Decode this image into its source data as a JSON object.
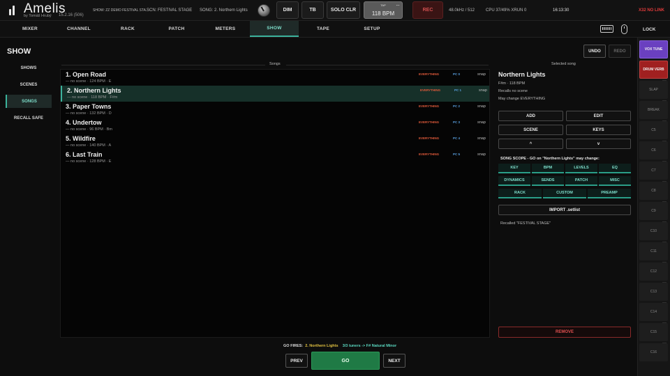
{
  "app": {
    "name": "Amelis",
    "author": "by Tomáš Hrubý",
    "version": "15.2.16 (506)"
  },
  "topbar": {
    "show": "SHOW: ZZ DEMO FESTIVAL STA...",
    "scene": "SCN: FESTIVAL STAGE",
    "song": "SONG: 2. Northern Lights",
    "dim": "DIM",
    "tb": "TB",
    "solo_clr": "SOLO CLR",
    "tap_label": "TAP",
    "tap_bpm": "118 BPM",
    "rec": "REC",
    "samplerate": "48.0kHz / 512",
    "cpu": "CPU 37/49%  XRUN 0",
    "clock": "16:13:30",
    "link_status": "X32 NO LINK"
  },
  "nav": {
    "tabs": [
      "MIXER",
      "CHANNEL",
      "RACK",
      "PATCH",
      "METERS",
      "SHOW",
      "TAPE",
      "SETUP"
    ],
    "active": "SHOW",
    "lock": "LOCK"
  },
  "page": {
    "title": "SHOW"
  },
  "sidebar": {
    "items": [
      "SHOWS",
      "SCENES",
      "SONGS",
      "RECALL SAFE"
    ],
    "active": "SONGS"
  },
  "history": {
    "undo": "UNDO",
    "redo": "REDO"
  },
  "songs": {
    "header": "Songs",
    "rows": [
      {
        "title": "1.  Open Road",
        "scene": "— no scene",
        "bpm": "124 BPM",
        "key": "E",
        "tag": "EVERYTHING",
        "pc": "PC 0",
        "snap": "snap"
      },
      {
        "title": "2.  Northern Lights",
        "scene": "— no scene",
        "bpm": "118 BPM",
        "key": "F#m",
        "tag": "EVERYTHING",
        "pc": "PC 1",
        "snap": "snap"
      },
      {
        "title": "3.  Paper Towns",
        "scene": "— no scene",
        "bpm": "132 BPM",
        "key": "D",
        "tag": "EVERYTHING",
        "pc": "PC 2",
        "snap": "snap"
      },
      {
        "title": "4.  Undertow",
        "scene": "— no scene",
        "bpm": "96 BPM",
        "key": "Bm",
        "tag": "EVERYTHING",
        "pc": "PC 3",
        "snap": "snap"
      },
      {
        "title": "5.  Wildfire",
        "scene": "— no scene",
        "bpm": "140 BPM",
        "key": "A",
        "tag": "EVERYTHING",
        "pc": "PC 4",
        "snap": "snap"
      },
      {
        "title": "6.  Last Train",
        "scene": "— no scene",
        "bpm": "128 BPM",
        "key": "E",
        "tag": "EVERYTHING",
        "pc": "PC 5",
        "snap": "snap"
      }
    ]
  },
  "selected": {
    "header": "Selected song",
    "title": "Northern Lights",
    "key_bpm": "F#m   ·   118 BPM",
    "recalls": "Recalls   no scene",
    "may_change": "May change  EVERYTHING",
    "buttons": {
      "add": "ADD",
      "edit": "EDIT",
      "scene": "SCENE",
      "keys": "KEYS",
      "up": "^",
      "down": "v"
    },
    "scope_label": "SONG SCOPE - GO on \"Northern Lights\" may change:",
    "scope": [
      "KEY",
      "BPM",
      "LEVELS",
      "EQ",
      "DYNAMICS",
      "SENDS",
      "PATCH",
      "MISC",
      "RACK",
      "CUSTOM",
      "PREAMP"
    ],
    "import": "IMPORT .setlist",
    "recalled": "Recalled \"FESTIVAL STAGE\"",
    "remove": "REMOVE"
  },
  "bottom": {
    "go_fires_label": "GO FIRES:",
    "go_fires_song": "2.   Northern Lights",
    "go_fires_detail": "3/3 tuners -> F# Natural Minor",
    "prev": "PREV",
    "go": "GO",
    "next": "NEXT"
  },
  "strip": [
    "VOX TUNE",
    "DRUM VERB",
    "SLAP",
    "BREAK",
    "C5",
    "C6",
    "C7",
    "C8",
    "C9",
    "C10",
    "C11",
    "C12",
    "C13",
    "C14",
    "C15",
    "C16"
  ]
}
